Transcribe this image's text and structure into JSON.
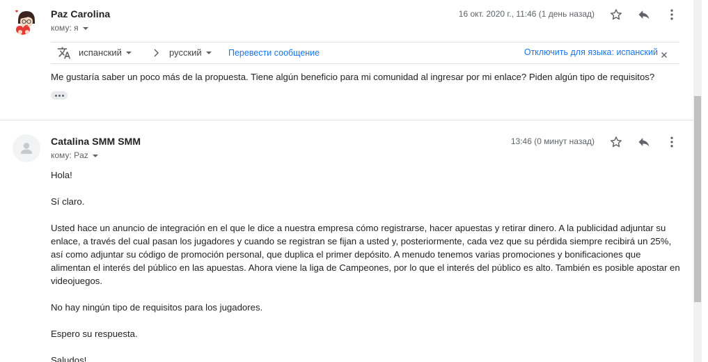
{
  "message1": {
    "sender": "Paz Carolina",
    "to_label": "кому: я",
    "date": "16 окт. 2020 г., 11:46 (1 день назад)",
    "translation": {
      "source_lang": "испанский",
      "target_lang": "русский",
      "translate_link": "Перевести сообщение",
      "disable_link": "Отключить для языка: испанский"
    },
    "body": "Me gustaría saber un poco más de la propuesta. Tiene algún beneficio para mi comunidad al ingresar por mi enlace? Piden algún tipo de requisitos?"
  },
  "message2": {
    "sender": "Catalina SMM SMM",
    "to_label": "кому: Paz",
    "date": "13:46 (0 минут назад)",
    "paragraphs": [
      "Hola!",
      "Sí claro.",
      "Usted hace un anuncio de integración en el que le dice a nuestra empresa cómo registrarse, hacer apuestas y retirar dinero. A la publicidad adjuntar su enlace, a través del cual pasan los jugadores y cuando se registran se fijan a usted y, posteriormente, cada vez que su pérdida siempre recibirá un 25%, así como adjuntar su código de promoción personal, que duplica el primer depósito. A menudo tenemos varias promociones y bonificaciones que alimentan el interés del público en las apuestas. Ahora viene la liga de Campeones, por lo que el interés del público es alto. También es posible apostar en videojuegos.",
      "No hay ningún tipo de requisitos para los jugadores.",
      "Espero su respuesta.",
      "Saludos!"
    ]
  },
  "colors": {
    "link": "#1a73e8",
    "muted": "#5f6368",
    "text": "#222222",
    "divider": "#e0e0e0"
  },
  "icons": {
    "star": "star-icon",
    "reply": "reply-icon",
    "more": "more-vert-icon",
    "translate": "translate-icon",
    "close": "close-icon",
    "chevron": "chevron-right-icon",
    "avatar_placeholder": "person-icon"
  }
}
